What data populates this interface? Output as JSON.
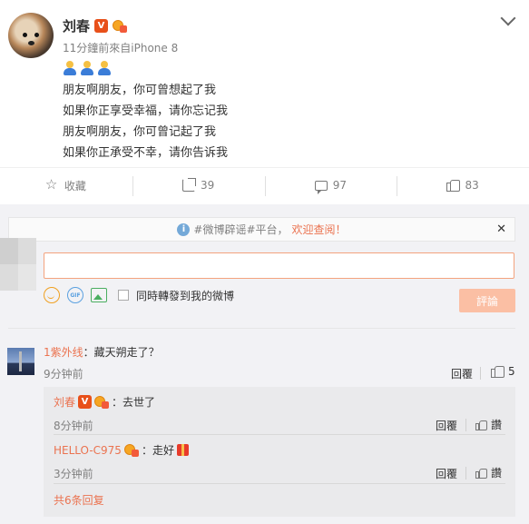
{
  "post": {
    "author": "刘春",
    "verified_badge": "V",
    "meta": "11分鐘前來自iPhone 8",
    "emoji_icons": [
      "people-emoji",
      "people-emoji",
      "people-emoji"
    ],
    "lines": [
      "朋友啊朋友，你可曾想起了我",
      "如果你正享受幸福，请你忘记我",
      "朋友啊朋友，你可曾记起了我",
      "如果你正承受不幸，请你告诉我"
    ]
  },
  "actions": {
    "favorite_label": "收藏",
    "share_count": "39",
    "comment_count": "97",
    "like_count": "83"
  },
  "notice": {
    "info_glyph": "i",
    "text": "#微博辟谣#平台，",
    "link": "欢迎查阅！",
    "close": "✕"
  },
  "composer": {
    "gif_label": "GIF",
    "repost_label": "同時轉發到我的微博",
    "submit_label": "評論"
  },
  "comment": {
    "author": "1紫外线",
    "text": "：藏天朔走了？",
    "time": "9分钟前",
    "reply_label": "回覆",
    "like_count": "5"
  },
  "replies": [
    {
      "author": "刘春",
      "badge": "V",
      "text": "：去世了",
      "time": "8分钟前",
      "reply_label": "回覆",
      "like_label": "讚"
    },
    {
      "author": "HELLO-C975",
      "text": "：走好",
      "time": "3分钟前",
      "reply_label": "回覆",
      "like_label": "讚"
    }
  ],
  "more_replies": "共6条回复",
  "colors": {
    "accent": "#eb7350",
    "muted": "#808080",
    "panel": "#f2f2f5"
  }
}
